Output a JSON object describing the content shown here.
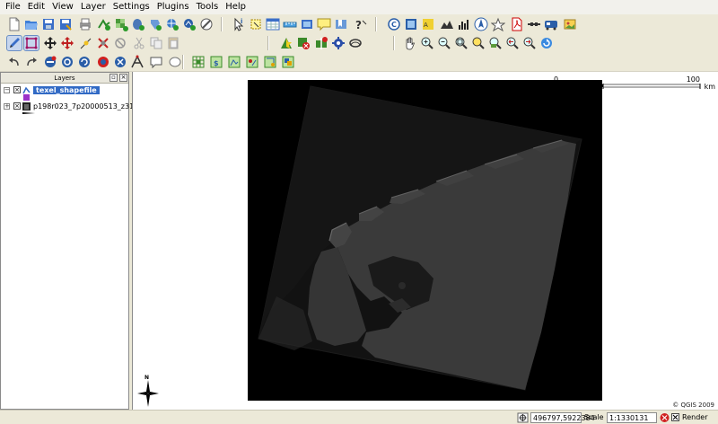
{
  "menu": [
    "File",
    "Edit",
    "View",
    "Layer",
    "Settings",
    "Plugins",
    "Tools",
    "Help"
  ],
  "layers_panel": {
    "title": "Layers",
    "items": [
      {
        "label": "texel_shapefile",
        "selected": true
      },
      {
        "label": "p198r023_7p20000513_z31...",
        "selected": false
      }
    ]
  },
  "map": {
    "north_label": "N",
    "scalebar": {
      "left": "0",
      "right": "100",
      "unit": "km"
    },
    "copyright": "© QGIS 2009"
  },
  "status": {
    "coordinates": "496797,5922384",
    "scale_label": "Scale",
    "scale_value": "1:1330131",
    "render_label": "Render"
  },
  "colors": {
    "selection": "#316ac5",
    "toolbar": "#ece9d8",
    "map_background": "#000000"
  }
}
